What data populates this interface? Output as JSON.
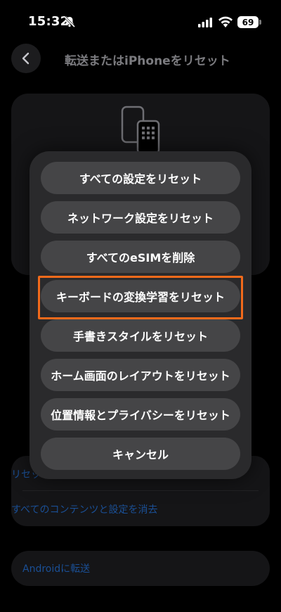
{
  "status_bar": {
    "time": "15:32",
    "battery": "69",
    "icons": [
      "bell-slash-icon",
      "signal-icon",
      "wifi-icon",
      "battery-icon"
    ]
  },
  "nav": {
    "back_icon": "chevron-left-icon",
    "title": "転送またはiPhoneをリセット"
  },
  "background": {
    "list_items": [
      "リセット",
      "すべてのコンテンツと設定を消去"
    ],
    "android_label": "Androidに転送"
  },
  "sheet": {
    "actions": [
      "すべての設定をリセット",
      "ネットワーク設定をリセット",
      "すべてのeSIMを削除",
      "キーボードの変換学習をリセット",
      "手書きスタイルをリセット",
      "ホーム画面のレイアウトをリセット",
      "位置情報とプライバシーをリセット",
      "キャンセル"
    ]
  },
  "colors": {
    "highlight": "#f26a1b",
    "link": "#0a84ff"
  }
}
